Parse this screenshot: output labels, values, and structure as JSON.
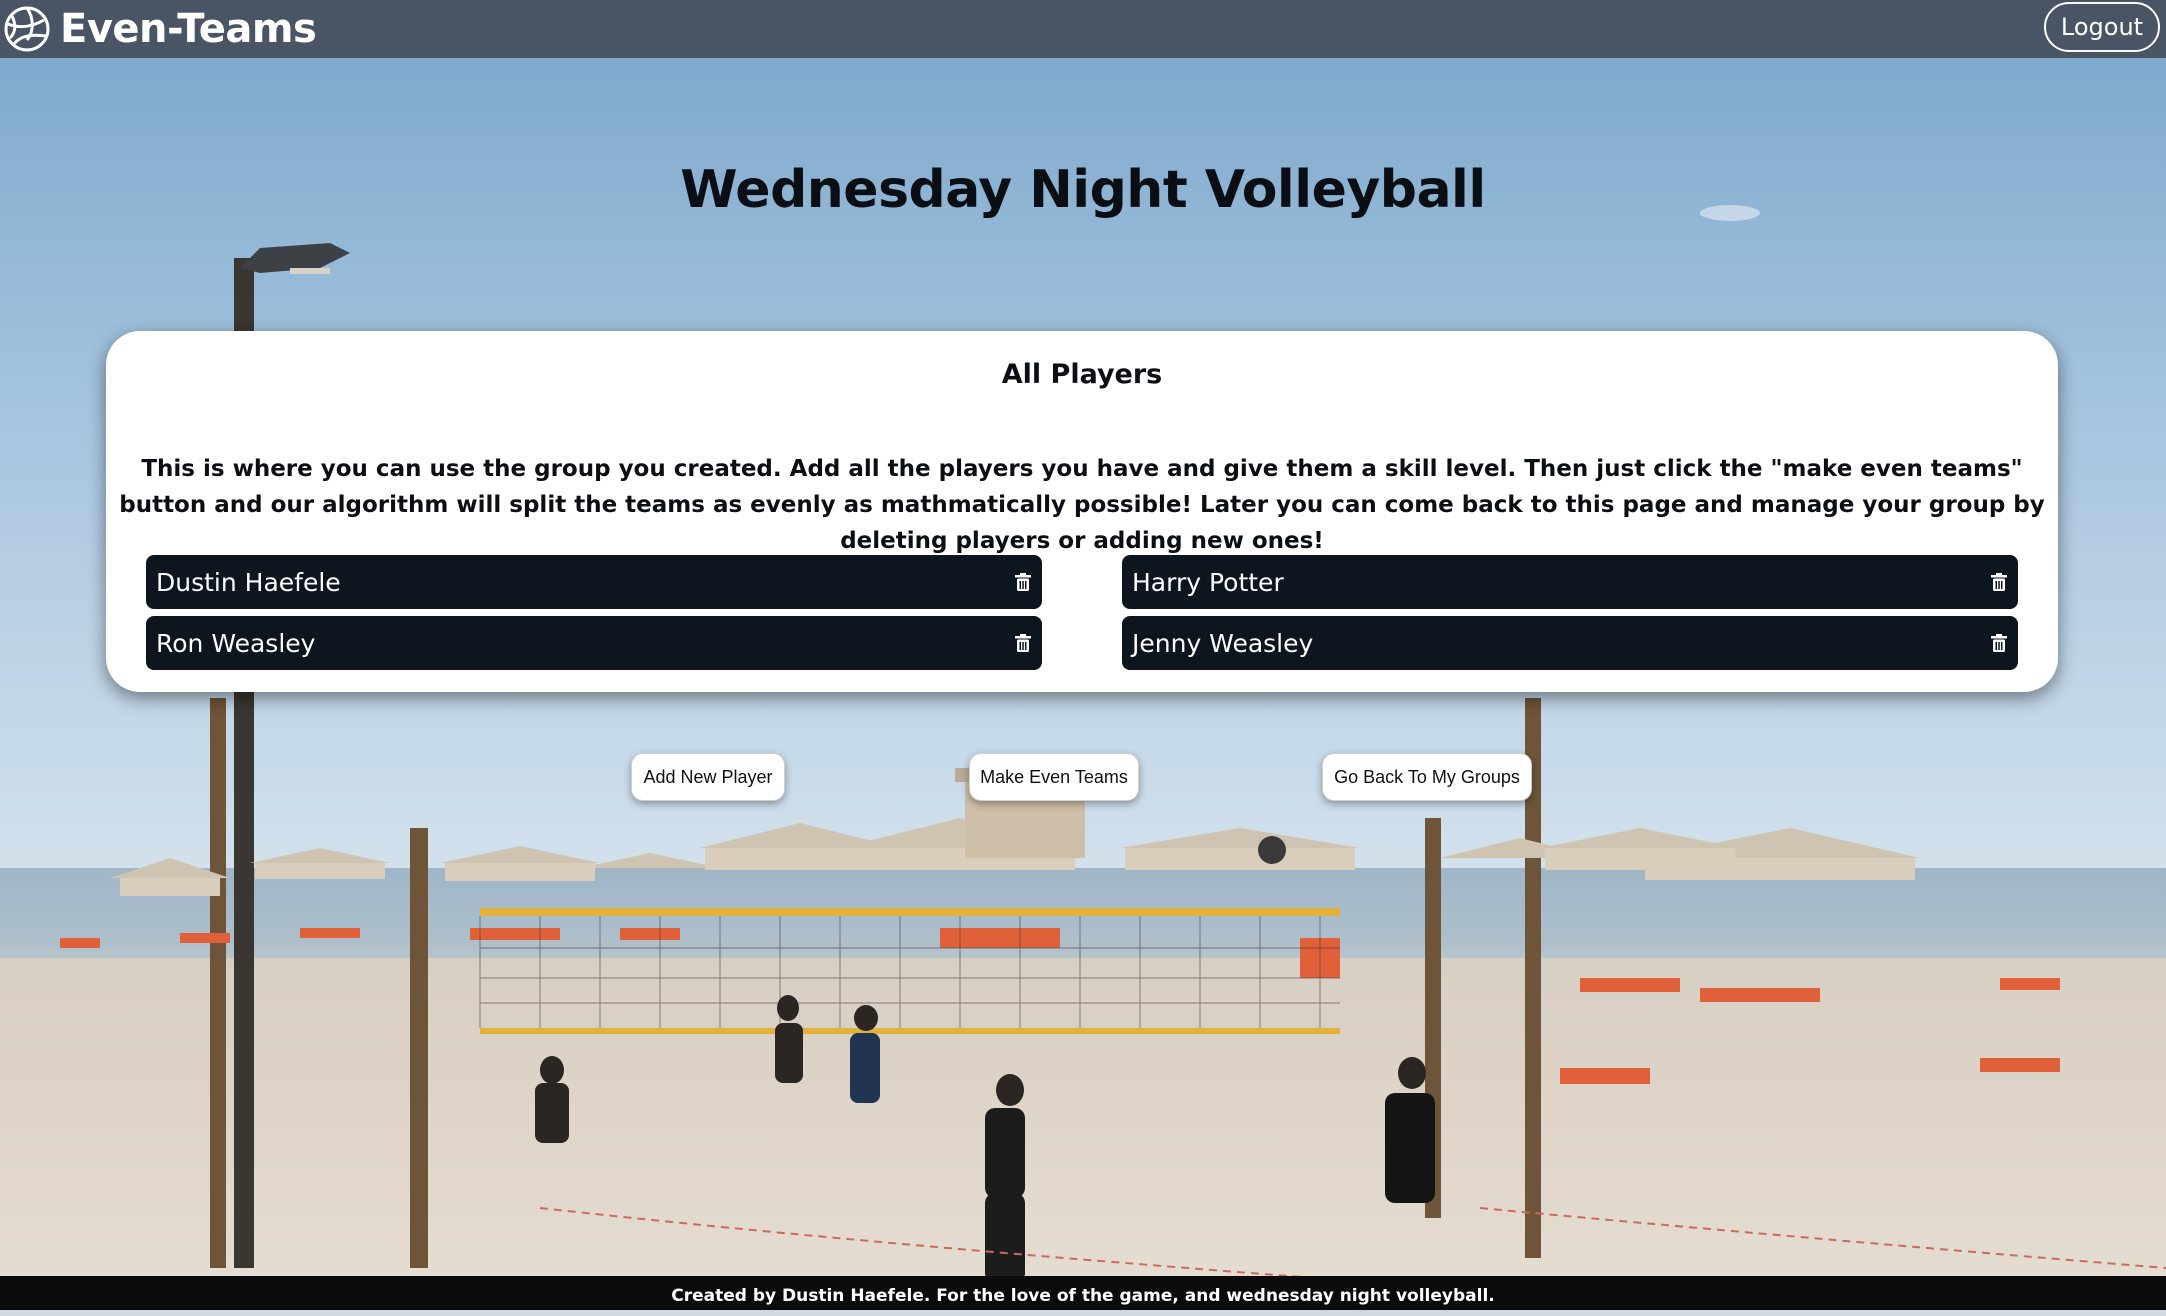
{
  "navbar": {
    "brand": "Even-Teams",
    "logo_icon": "volleyball-icon",
    "logout_label": "Logout"
  },
  "page": {
    "title": "Wednesday Night Volleyball"
  },
  "card": {
    "title": "All Players",
    "description": "This is where you can use the group you created. Add all the players you have and give them a skill level. Then just click the \"make even teams\" button and our algorithm will split the teams as evenly as mathmatically possible! Later you can come back to this page and manage your group by deleting players or adding new ones!",
    "players": [
      {
        "name": "Dustin Haefele",
        "icon": "trash-icon"
      },
      {
        "name": "Harry Potter",
        "icon": "trash-icon"
      },
      {
        "name": "Ron Weasley",
        "icon": "trash-icon"
      },
      {
        "name": "Jenny Weasley",
        "icon": "trash-icon"
      }
    ]
  },
  "actions": {
    "add_player": "Add New Player",
    "make_teams": "Make Even Teams",
    "go_back": "Go Back To My Groups"
  },
  "footer": {
    "text": "Created by Dustin Haefele. For the love of the game, and wednesday night volleyball."
  },
  "colors": {
    "navbar": "#495465",
    "player_row": "#0d161f",
    "footer": "#0b0b0b"
  }
}
